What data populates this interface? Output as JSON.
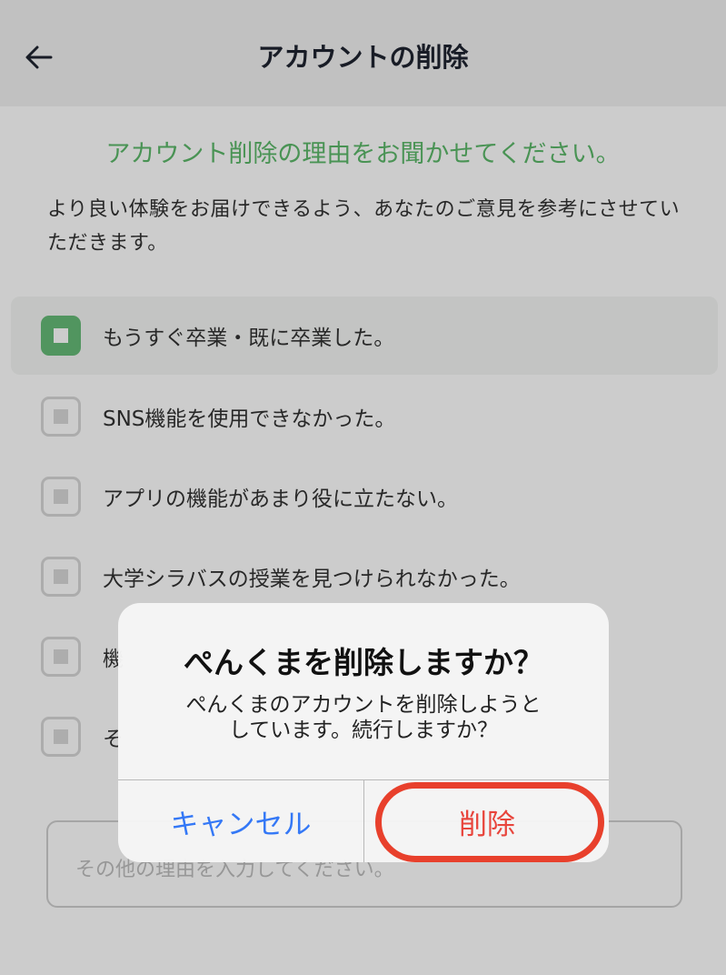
{
  "header": {
    "title": "アカウントの削除"
  },
  "content": {
    "title": "アカウント削除の理由をお聞かせてください。",
    "description": "より良い体験をお届けできるよう、あなたのご意見を参考にさせていただきます。"
  },
  "reasons": [
    {
      "label": "もうすぐ卒業・既に卒業した。",
      "checked": true
    },
    {
      "label": "SNS機能を使用できなかった。",
      "checked": false
    },
    {
      "label": "アプリの機能があまり役に立たない。",
      "checked": false
    },
    {
      "label": "大学シラバスの授業を見つけられなかった。",
      "checked": false
    },
    {
      "label": "機",
      "checked": false
    },
    {
      "label": "そ",
      "checked": false
    }
  ],
  "other_input": {
    "placeholder": "その他の理由を入力してください。"
  },
  "dialog": {
    "title": "ぺんくまを削除しますか？",
    "message_line1": "ぺんくまのアカウントを削除しようと",
    "message_line2": "しています。続行しますか？",
    "cancel_label": "キャンセル",
    "delete_label": "削除"
  },
  "colors": {
    "accent_green": "#5cb86a",
    "cancel_blue": "#3478f6",
    "delete_red": "#e8453c",
    "highlight_ring": "#e8402c"
  }
}
